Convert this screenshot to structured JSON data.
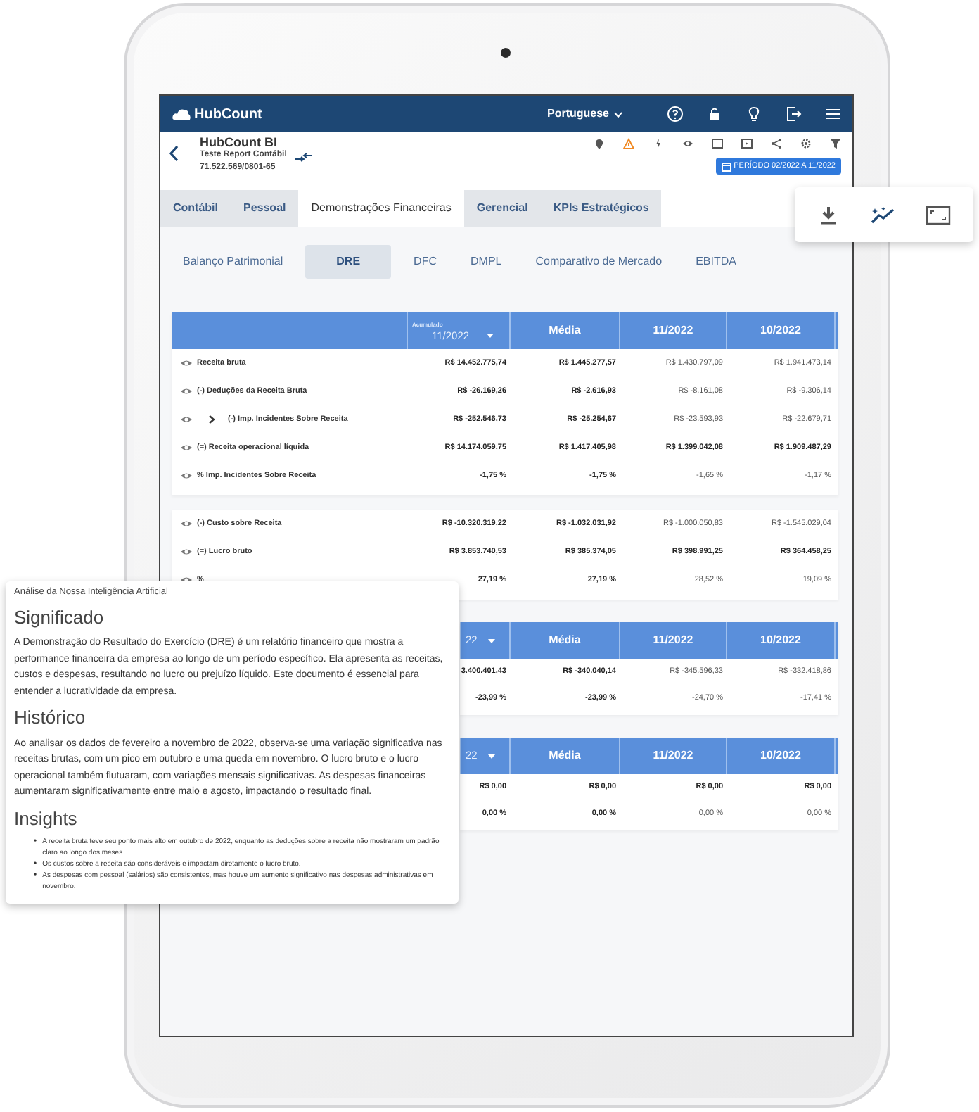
{
  "navbar": {
    "logo_text": "HubCount",
    "language": "Portuguese"
  },
  "header": {
    "title": "HubCount BI",
    "company": "Teste Report Contábil",
    "cnpj": "71.522.569/0801-65",
    "period": "PERÍODO 02/2022 A 11/2022"
  },
  "tabs": [
    {
      "label": "Contábil",
      "selected": false
    },
    {
      "label": "Pessoal",
      "selected": false
    },
    {
      "label": "Demonstrações Financeiras",
      "selected": true
    },
    {
      "label": "Gerencial",
      "selected": false
    },
    {
      "label": "KPIs Estratégicos",
      "selected": false
    }
  ],
  "subtabs": [
    {
      "label": "Balanço Patrimonial",
      "selected": false
    },
    {
      "label": "DRE",
      "selected": true
    },
    {
      "label": "DFC",
      "selected": false
    },
    {
      "label": "DMPL",
      "selected": false
    },
    {
      "label": "Comparativo de Mercado",
      "selected": false
    },
    {
      "label": "EBITDA",
      "selected": false
    }
  ],
  "tables": [
    {
      "kind": "full",
      "header": {
        "dropdown_label": "Acumulado",
        "dropdown_value": "11/2022",
        "columns": [
          "Média",
          "11/2022",
          "10/2022"
        ]
      },
      "rows": [
        {
          "label": "Receita bruta",
          "expandable": false,
          "emphasis": false,
          "values": [
            "R$ 14.452.775,74",
            "R$ 1.445.277,57",
            "R$ 1.430.797,09",
            "R$ 1.941.473,14"
          ]
        },
        {
          "label": "(-) Deduções da Receita Bruta",
          "expandable": false,
          "emphasis": false,
          "values": [
            "R$ -26.169,26",
            "R$ -2.616,93",
            "R$ -8.161,08",
            "R$ -9.306,14"
          ]
        },
        {
          "label": "(-) Imp. Incidentes Sobre Receita",
          "expandable": true,
          "emphasis": false,
          "values": [
            "R$ -252.546,73",
            "R$ -25.254,67",
            "R$ -23.593,93",
            "R$ -22.679,71"
          ]
        },
        {
          "label": "(=) Receita operacional líquida",
          "expandable": false,
          "emphasis": true,
          "values": [
            "R$ 14.174.059,75",
            "R$ 1.417.405,98",
            "R$ 1.399.042,08",
            "R$ 1.909.487,29"
          ]
        },
        {
          "label": "% Imp. Incidentes Sobre Receita",
          "expandable": false,
          "emphasis": false,
          "values": [
            "-1,75 %",
            "-1,75 %",
            "-1,65 %",
            "-1,17 %"
          ]
        }
      ]
    },
    {
      "kind": "body",
      "rows": [
        {
          "label": "(-) Custo sobre Receita",
          "expandable": false,
          "emphasis": false,
          "values": [
            "R$ -10.320.319,22",
            "R$ -1.032.031,92",
            "R$ -1.000.050,83",
            "R$ -1.545.029,04"
          ]
        },
        {
          "label": "(=) Lucro bruto",
          "expandable": false,
          "emphasis": true,
          "values": [
            "R$ 3.853.740,53",
            "R$ 385.374,05",
            "R$ 398.991,25",
            "R$ 364.458,25"
          ]
        },
        {
          "label": "%",
          "expandable": false,
          "emphasis": false,
          "values": [
            "27,19 %",
            "27,19 %",
            "28,52 %",
            "19,09 %"
          ]
        }
      ]
    },
    {
      "kind": "partial",
      "header": {
        "dropdown_value": "22",
        "columns": [
          "Média",
          "11/2022",
          "10/2022"
        ]
      },
      "rows": [
        {
          "emphasis": false,
          "values": [
            "3.400.401,43",
            "R$ -340.040,14",
            "R$ -345.596,33",
            "R$ -332.418,86"
          ]
        },
        {
          "emphasis": false,
          "values": [
            "-23,99 %",
            "-23,99 %",
            "-24,70 %",
            "-17,41 %"
          ]
        }
      ]
    },
    {
      "kind": "partial",
      "header": {
        "dropdown_value": "22",
        "columns": [
          "Média",
          "11/2022",
          "10/2022"
        ]
      },
      "rows": [
        {
          "emphasis": true,
          "values": [
            "R$ 0,00",
            "R$ 0,00",
            "R$ 0,00",
            "R$ 0,00"
          ]
        },
        {
          "emphasis": false,
          "values": [
            "0,00 %",
            "0,00 %",
            "0,00 %",
            "0,00 %"
          ]
        }
      ]
    }
  ],
  "ai_panel": {
    "caption": "Análise da Nossa Inteligência Artificial",
    "sections": [
      {
        "kind": "paragraph",
        "heading": "Significado",
        "text": "A Demonstração do Resultado do Exercício (DRE) é um relatório financeiro que mostra a performance financeira da empresa ao longo de um período específico. Ela apresenta as receitas, custos e despesas, resultando no lucro ou prejuízo líquido. Este documento é essencial para entender a lucratividade da empresa."
      },
      {
        "kind": "paragraph",
        "heading": "Histórico",
        "text": "Ao analisar os dados de fevereiro a novembro de 2022, observa-se uma variação significativa nas receitas brutas, com um pico em outubro e uma queda em novembro. O lucro bruto e o lucro operacional também flutuaram, com variações mensais significativas. As despesas financeiras aumentaram significativamente entre maio e agosto, impactando o resultado final."
      },
      {
        "kind": "bullets",
        "heading": "Insights",
        "marker": "•",
        "items": [
          "A receita bruta teve seu ponto mais alto em outubro de 2022, enquanto as deduções sobre a receita não mostraram um padrão claro ao longo dos meses.",
          "Os custos sobre a receita são consideráveis e impactam diretamente o lucro bruto.",
          "As despesas com pessoal (salários) são consistentes, mas houve um aumento significativo nas despesas administrativas em novembro."
        ]
      }
    ]
  }
}
